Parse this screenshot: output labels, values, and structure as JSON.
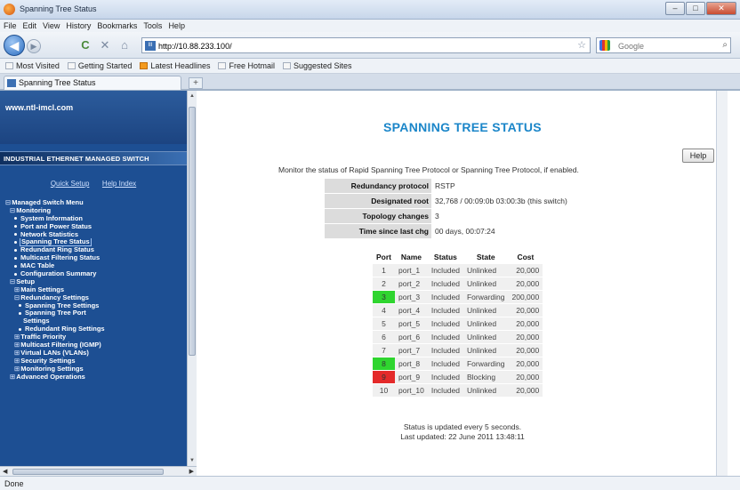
{
  "window": {
    "title": "Spanning Tree Status"
  },
  "menu": [
    "File",
    "Edit",
    "View",
    "History",
    "Bookmarks",
    "Tools",
    "Help"
  ],
  "nav": {
    "url": "http://10.88.233.100/",
    "search_placeholder": "Google",
    "back_glyph": "◀",
    "forward_glyph": "▶",
    "reload_glyph": "C",
    "stop_glyph": "✕",
    "home_glyph": "⌂"
  },
  "bookmarks": [
    "Most Visited",
    "Getting Started",
    "Latest Headlines",
    "Free Hotmail",
    "Suggested Sites"
  ],
  "tab": {
    "label": "Spanning Tree Status",
    "new_tab_glyph": "+"
  },
  "sidebar": {
    "site": "www.ntl-imcl.com",
    "banner": "INDUSTRIAL ETHERNET MANAGED SWITCH",
    "links": [
      "Quick Setup",
      "Help Index"
    ],
    "tree": [
      {
        "pm": "⊟",
        "text": "Managed Switch Menu",
        "indent": 0,
        "bullet": false
      },
      {
        "pm": "⊟",
        "text": "Monitoring",
        "indent": 1,
        "bullet": false
      },
      {
        "pm": "",
        "text": "System Information",
        "indent": 2,
        "bullet": true
      },
      {
        "pm": "",
        "text": "Port and Power Status",
        "indent": 2,
        "bullet": true
      },
      {
        "pm": "",
        "text": "Network Statistics",
        "indent": 2,
        "bullet": true
      },
      {
        "pm": "",
        "text": "Spanning Tree Status",
        "indent": 2,
        "bullet": true,
        "selected": true
      },
      {
        "pm": "",
        "text": "Redundant Ring Status",
        "indent": 2,
        "bullet": true
      },
      {
        "pm": "",
        "text": "Multicast Filtering Status",
        "indent": 2,
        "bullet": true
      },
      {
        "pm": "",
        "text": "MAC Table",
        "indent": 2,
        "bullet": true
      },
      {
        "pm": "",
        "text": "Configuration Summary",
        "indent": 2,
        "bullet": true
      },
      {
        "pm": "⊟",
        "text": "Setup",
        "indent": 1,
        "bullet": false
      },
      {
        "pm": "⊞",
        "text": "Main Settings",
        "indent": 2,
        "bullet": false
      },
      {
        "pm": "⊟",
        "text": "Redundancy Settings",
        "indent": 2,
        "bullet": false
      },
      {
        "pm": "",
        "text": "Spanning Tree Settings",
        "indent": 3,
        "bullet": true
      },
      {
        "pm": "",
        "text": "Spanning Tree Port",
        "indent": 3,
        "bullet": true
      },
      {
        "pm": "",
        "text": "Settings",
        "indent": 4,
        "bullet": false
      },
      {
        "pm": "",
        "text": "Redundant Ring Settings",
        "indent": 3,
        "bullet": true
      },
      {
        "pm": "⊞",
        "text": "Traffic Priority",
        "indent": 2,
        "bullet": false
      },
      {
        "pm": "⊞",
        "text": "Multicast Filtering (IGMP)",
        "indent": 2,
        "bullet": false
      },
      {
        "pm": "⊞",
        "text": "Virtual LANs (VLANs)",
        "indent": 2,
        "bullet": false
      },
      {
        "pm": "⊞",
        "text": "Security Settings",
        "indent": 2,
        "bullet": false
      },
      {
        "pm": "⊞",
        "text": "Monitoring Settings",
        "indent": 2,
        "bullet": false
      },
      {
        "pm": "⊞",
        "text": "Advanced Operations",
        "indent": 1,
        "bullet": false
      }
    ]
  },
  "main": {
    "title": "SPANNING TREE STATUS",
    "help_label": "Help",
    "monitor_text": "Monitor the status of Rapid Spanning Tree Protocol or Spanning Tree Protocol, if enabled.",
    "info": [
      {
        "label": "Redundancy protocol",
        "value": "RSTP"
      },
      {
        "label": "Designated root",
        "value": "32,768 / 00:09:0b 03:00:3b (this switch)"
      },
      {
        "label": "Topology changes",
        "value": "3"
      },
      {
        "label": "Time since last chg",
        "value": "00 days, 00:07:24"
      }
    ],
    "port_headers": [
      "Port",
      "Name",
      "Status",
      "State",
      "Cost"
    ],
    "ports": [
      {
        "port": "1",
        "name": "port_1",
        "status": "Included",
        "state": "Unlinked",
        "cost": "20,000",
        "color": ""
      },
      {
        "port": "2",
        "name": "port_2",
        "status": "Included",
        "state": "Unlinked",
        "cost": "20,000",
        "color": ""
      },
      {
        "port": "3",
        "name": "port_3",
        "status": "Included",
        "state": "Forwarding",
        "cost": "200,000",
        "color": "green"
      },
      {
        "port": "4",
        "name": "port_4",
        "status": "Included",
        "state": "Unlinked",
        "cost": "20,000",
        "color": ""
      },
      {
        "port": "5",
        "name": "port_5",
        "status": "Included",
        "state": "Unlinked",
        "cost": "20,000",
        "color": ""
      },
      {
        "port": "6",
        "name": "port_6",
        "status": "Included",
        "state": "Unlinked",
        "cost": "20,000",
        "color": ""
      },
      {
        "port": "7",
        "name": "port_7",
        "status": "Included",
        "state": "Unlinked",
        "cost": "20,000",
        "color": ""
      },
      {
        "port": "8",
        "name": "port_8",
        "status": "Included",
        "state": "Forwarding",
        "cost": "20,000",
        "color": "green"
      },
      {
        "port": "9",
        "name": "port_9",
        "status": "Included",
        "state": "Blocking",
        "cost": "20,000",
        "color": "red"
      },
      {
        "port": "10",
        "name": "port_10",
        "status": "Included",
        "state": "Unlinked",
        "cost": "20,000",
        "color": ""
      }
    ],
    "footer_line1": "Status is updated every 5 seconds.",
    "footer_line2": "Last updated: 22 June 2011 13:48:11"
  },
  "statusbar": {
    "text": "Done"
  },
  "colors": {
    "port_forwarding": "#2fd52f",
    "port_blocking": "#e42a2a",
    "title_blue": "#1b86c9",
    "sidebar_blue": "#1d4f93"
  }
}
